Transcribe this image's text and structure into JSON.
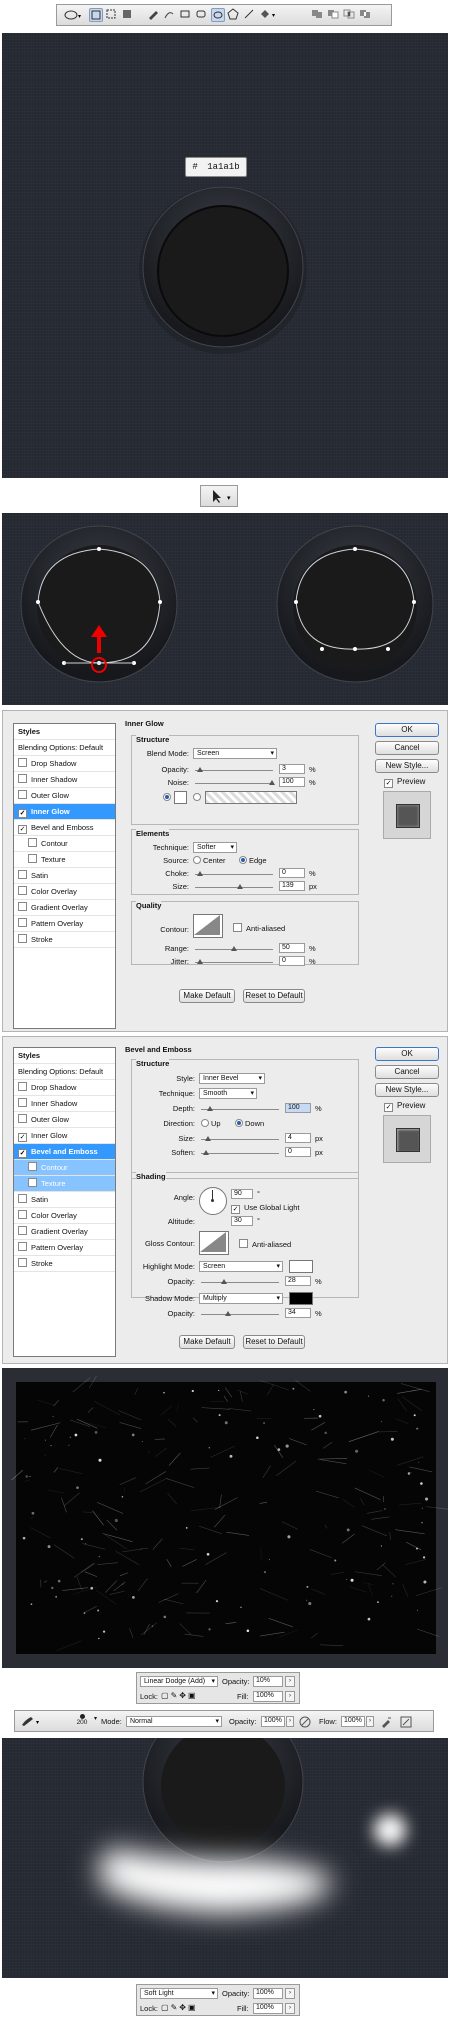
{
  "top_toolbar": {
    "tools": [
      "ellipse-tool",
      "shape-layers",
      "paths",
      "fill-pixels",
      "pen-tool",
      "freeform-pen",
      "rectangle",
      "rounded-rectangle",
      "ellipse",
      "polygon",
      "line",
      "custom-shape",
      "combine",
      "subtract",
      "intersect",
      "exclude"
    ]
  },
  "canvas1": {
    "hex_label": "#",
    "hex_value": "1a1a1b"
  },
  "select_tool": {
    "label": "path selection"
  },
  "inner_glow_dialog": {
    "styles_header": "Styles",
    "blending_options": "Blending Options: Default",
    "items": [
      {
        "label": "Drop Shadow",
        "checked": false,
        "selected": false,
        "sub": false
      },
      {
        "label": "Inner Shadow",
        "checked": false,
        "selected": false,
        "sub": false
      },
      {
        "label": "Outer Glow",
        "checked": false,
        "selected": false,
        "sub": false
      },
      {
        "label": "Inner Glow",
        "checked": true,
        "selected": true,
        "sub": false
      },
      {
        "label": "Bevel and Emboss",
        "checked": true,
        "selected": false,
        "sub": false
      },
      {
        "label": "Contour",
        "checked": false,
        "selected": false,
        "sub": true
      },
      {
        "label": "Texture",
        "checked": false,
        "selected": false,
        "sub": true
      },
      {
        "label": "Satin",
        "checked": false,
        "selected": false,
        "sub": false
      },
      {
        "label": "Color Overlay",
        "checked": false,
        "selected": false,
        "sub": false
      },
      {
        "label": "Gradient Overlay",
        "checked": false,
        "selected": false,
        "sub": false
      },
      {
        "label": "Pattern Overlay",
        "checked": false,
        "selected": false,
        "sub": false
      },
      {
        "label": "Stroke",
        "checked": false,
        "selected": false,
        "sub": false
      }
    ],
    "title": "Inner Glow",
    "structure": "Structure",
    "blend_mode_label": "Blend Mode:",
    "blend_mode": "Screen",
    "opacity_label": "Opacity:",
    "opacity": "3",
    "pct": "%",
    "noise_label": "Noise:",
    "noise": "100",
    "elements": "Elements",
    "technique_label": "Technique:",
    "technique": "Softer",
    "source_label": "Source:",
    "center": "Center",
    "edge": "Edge",
    "choke_label": "Choke:",
    "choke": "0",
    "size_label": "Size:",
    "size": "139",
    "px": "px",
    "quality": "Quality",
    "contour_label": "Contour:",
    "anti_aliased": "Anti-aliased",
    "range_label": "Range:",
    "range": "50",
    "jitter_label": "Jitter:",
    "jitter": "0",
    "make_default": "Make Default",
    "reset_default": "Reset to Default",
    "ok": "OK",
    "cancel": "Cancel",
    "new_style": "New Style...",
    "preview": "Preview"
  },
  "bevel_dialog": {
    "styles_header": "Styles",
    "blending_options": "Blending Options: Default",
    "items": [
      {
        "label": "Drop Shadow",
        "checked": false,
        "selected": false,
        "sub": false
      },
      {
        "label": "Inner Shadow",
        "checked": false,
        "selected": false,
        "sub": false
      },
      {
        "label": "Outer Glow",
        "checked": false,
        "selected": false,
        "sub": false
      },
      {
        "label": "Inner Glow",
        "checked": true,
        "selected": false,
        "sub": false
      },
      {
        "label": "Bevel and Emboss",
        "checked": true,
        "selected": true,
        "sub": false
      },
      {
        "label": "Contour",
        "checked": false,
        "selected": false,
        "sub": true
      },
      {
        "label": "Texture",
        "checked": false,
        "selected": false,
        "sub": true
      },
      {
        "label": "Satin",
        "checked": false,
        "selected": false,
        "sub": false
      },
      {
        "label": "Color Overlay",
        "checked": false,
        "selected": false,
        "sub": false
      },
      {
        "label": "Gradient Overlay",
        "checked": false,
        "selected": false,
        "sub": false
      },
      {
        "label": "Pattern Overlay",
        "checked": false,
        "selected": false,
        "sub": false
      },
      {
        "label": "Stroke",
        "checked": false,
        "selected": false,
        "sub": false
      }
    ],
    "title": "Bevel and Emboss",
    "structure": "Structure",
    "style_label": "Style:",
    "style": "Inner Bevel",
    "technique_label": "Technique:",
    "technique": "Smooth",
    "depth_label": "Depth:",
    "depth": "100",
    "pct": "%",
    "direction_label": "Direction:",
    "up": "Up",
    "down": "Down",
    "size_label": "Size:",
    "size": "4",
    "px": "px",
    "soften_label": "Soften:",
    "soften": "0",
    "shading": "Shading",
    "angle_label": "Angle:",
    "angle": "90",
    "deg": "°",
    "global_light": "Use Global Light",
    "altitude_label": "Altitude:",
    "altitude": "30",
    "gloss_label": "Gloss Contour:",
    "anti_aliased": "Anti-aliased",
    "highlight_label": "Highlight Mode:",
    "highlight_mode": "Screen",
    "h_opacity_label": "Opacity:",
    "h_opacity": "28",
    "shadow_label": "Shadow Mode:",
    "shadow_mode": "Multiply",
    "s_opacity_label": "Opacity:",
    "s_opacity": "34",
    "make_default": "Make Default",
    "reset_default": "Reset to Default",
    "ok": "OK",
    "cancel": "Cancel",
    "new_style": "New Style...",
    "preview": "Preview"
  },
  "layers1": {
    "blend": "Linear Dodge (Add)",
    "opacity_label": "Opacity:",
    "opacity": "10%",
    "lock_label": "Lock:",
    "fill_label": "Fill:",
    "fill": "100%"
  },
  "brush_bar": {
    "size": "200",
    "mode_label": "Mode:",
    "mode": "Normal",
    "opacity_label": "Opacity:",
    "opacity": "100%",
    "flow_label": "Flow:",
    "flow": "100%"
  },
  "layers2": {
    "blend": "Soft Light",
    "opacity_label": "Opacity:",
    "opacity": "100%",
    "lock_label": "Lock:",
    "fill_label": "Fill:",
    "fill": "100%"
  }
}
